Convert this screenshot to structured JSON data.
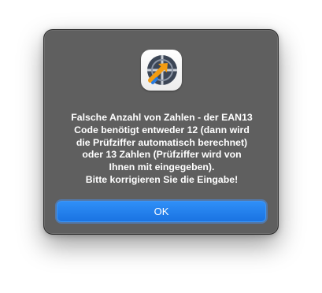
{
  "dialog": {
    "icon": "orange-arrow-app-icon",
    "message_lines": [
      "Falsche Anzahl von Zahlen - der EAN13",
      "Code benötigt entweder 12 (dann wird",
      "die Prüfziffer automatisch berechnet)",
      "oder 13 Zahlen (Prüfziffer wird von",
      "Ihnen mit eingegeben).",
      "Bitte korrigieren Sie die Eingabe!"
    ],
    "ok_label": "OK"
  },
  "colors": {
    "dialog_background": "#5f5f5f",
    "button_accent": "#1a73e2",
    "icon_orange": "#f39c12"
  }
}
